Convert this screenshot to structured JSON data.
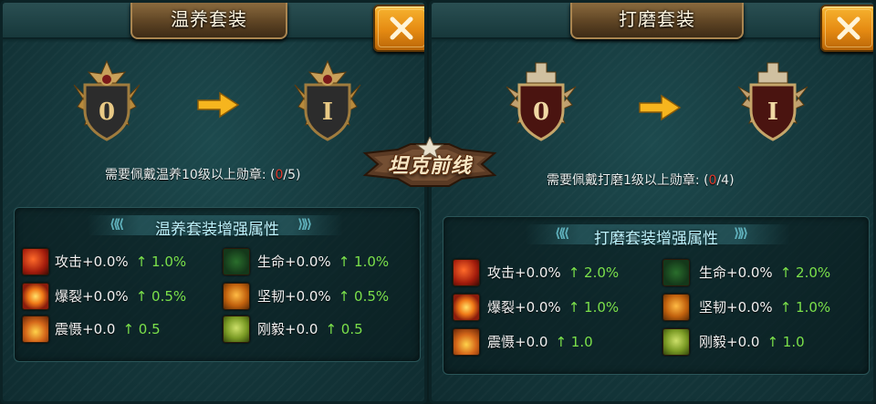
{
  "logo": {
    "text": "坦克前线"
  },
  "panels": [
    {
      "title": "温养套装",
      "badge_from": "0",
      "badge_to": "I",
      "requirement": {
        "prefix": "需要佩戴温养10级以上勋章: (",
        "current": "0",
        "suffix": "/5)"
      },
      "attributes_title": "温养套装增强属性",
      "stats": [
        {
          "icon": "attack-icon",
          "name": "攻击+0.0%",
          "bonus": "1.0%"
        },
        {
          "icon": "life-icon",
          "name": "生命+0.0%",
          "bonus": "1.0%"
        },
        {
          "icon": "burst-icon",
          "name": "爆裂+0.0%",
          "bonus": "0.5%"
        },
        {
          "icon": "toughness-icon",
          "name": "坚韧+0.0%",
          "bonus": "0.5%"
        },
        {
          "icon": "shock-icon",
          "name": "震慑+0.0",
          "bonus": "0.5"
        },
        {
          "icon": "fortitude-icon",
          "name": "刚毅+0.0",
          "bonus": "0.5"
        }
      ]
    },
    {
      "title": "打磨套装",
      "badge_from": "0",
      "badge_to": "I",
      "requirement": {
        "prefix": "需要佩戴打磨1级以上勋章: (",
        "current": "0",
        "suffix": "/4)"
      },
      "attributes_title": "打磨套装增强属性",
      "stats": [
        {
          "icon": "attack-icon",
          "name": "攻击+0.0%",
          "bonus": "2.0%"
        },
        {
          "icon": "life-icon",
          "name": "生命+0.0%",
          "bonus": "2.0%"
        },
        {
          "icon": "burst-icon",
          "name": "爆裂+0.0%",
          "bonus": "1.0%"
        },
        {
          "icon": "toughness-icon",
          "name": "坚韧+0.0%",
          "bonus": "1.0%"
        },
        {
          "icon": "shock-icon",
          "name": "震慑+0.0",
          "bonus": "1.0"
        },
        {
          "icon": "fortitude-icon",
          "name": "刚毅+0.0",
          "bonus": "1.0"
        }
      ]
    }
  ],
  "up_arrow": "↑",
  "colors": {
    "requirement_count": "#e23b2e",
    "bonus": "#7be04a",
    "title_tab": "#5e4424",
    "close_button": "#e58a12"
  }
}
